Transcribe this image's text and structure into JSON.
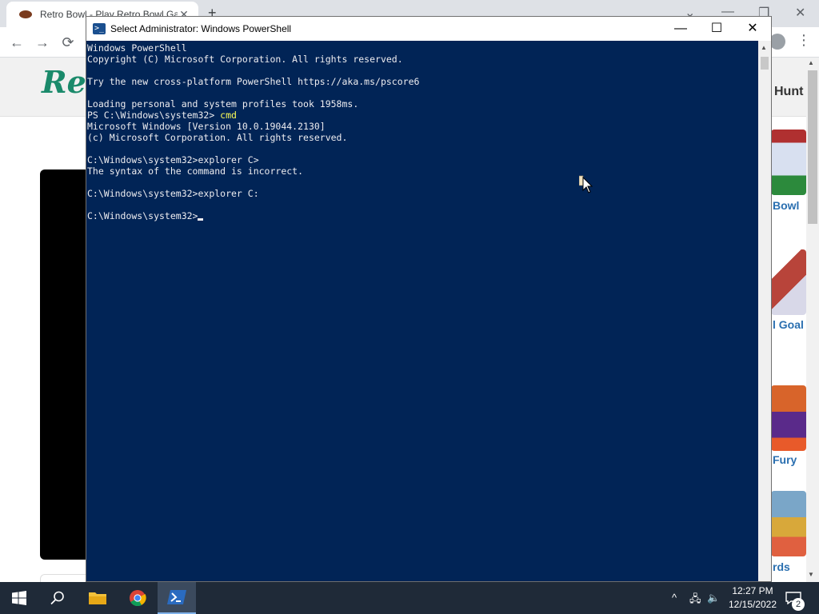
{
  "browser": {
    "tab_title": "Retro Bowl - Play Retro Bowl Gam",
    "tab_close": "✕",
    "new_tab": "+",
    "win_minimize": "—",
    "win_restore": "❐",
    "win_close": "✕",
    "back": "←",
    "forward": "→",
    "reload": "⟳",
    "menu": "⋮",
    "site_logo": "Ret",
    "nav_hunt": "Hunt",
    "thumbs": [
      {
        "label": "Bowl",
        "color": "#c8d8e8"
      },
      {
        "label": "l Goal",
        "color": "#b8443a"
      },
      {
        "label": "Fury",
        "color": "#d8642a"
      },
      {
        "label": "rds",
        "color": "#7aa6c8"
      }
    ]
  },
  "powershell": {
    "title": "Select Administrator: Windows PowerShell",
    "icon_glyph": ">_",
    "minimize": "—",
    "maximize": "☐",
    "close": "✕",
    "lines": [
      {
        "text": "Windows PowerShell"
      },
      {
        "text": "Copyright (C) Microsoft Corporation. All rights reserved."
      },
      {
        "text": ""
      },
      {
        "text": "Try the new cross-platform PowerShell https://aka.ms/pscore6"
      },
      {
        "text": ""
      },
      {
        "text": "Loading personal and system profiles took 1958ms."
      },
      {
        "prompt": "PS C:\\Windows\\system32> ",
        "cmd": "cmd"
      },
      {
        "text": "Microsoft Windows [Version 10.0.19044.2130]"
      },
      {
        "text": "(c) Microsoft Corporation. All rights reserved."
      },
      {
        "text": ""
      },
      {
        "text": "C:\\Windows\\system32>explorer C>"
      },
      {
        "text": "The syntax of the command is incorrect."
      },
      {
        "text": ""
      },
      {
        "text": "C:\\Windows\\system32>explorer C:"
      },
      {
        "text": ""
      },
      {
        "prompt": "C:\\Windows\\system32>",
        "cursor": true
      }
    ]
  },
  "taskbar": {
    "start_icon": "windows-logo",
    "search_icon": "search",
    "apps": [
      "file-explorer",
      "chrome",
      "powershell"
    ],
    "tray_chevron": "^",
    "network": "🖧",
    "volume": "🔈",
    "time": "12:27 PM",
    "date": "12/15/2022",
    "notifications_count": "2"
  },
  "colors": {
    "ps_background": "#012456",
    "ps_text": "#eeedf0",
    "ps_command": "#fcfc56",
    "taskbar": "#1f2a38"
  }
}
